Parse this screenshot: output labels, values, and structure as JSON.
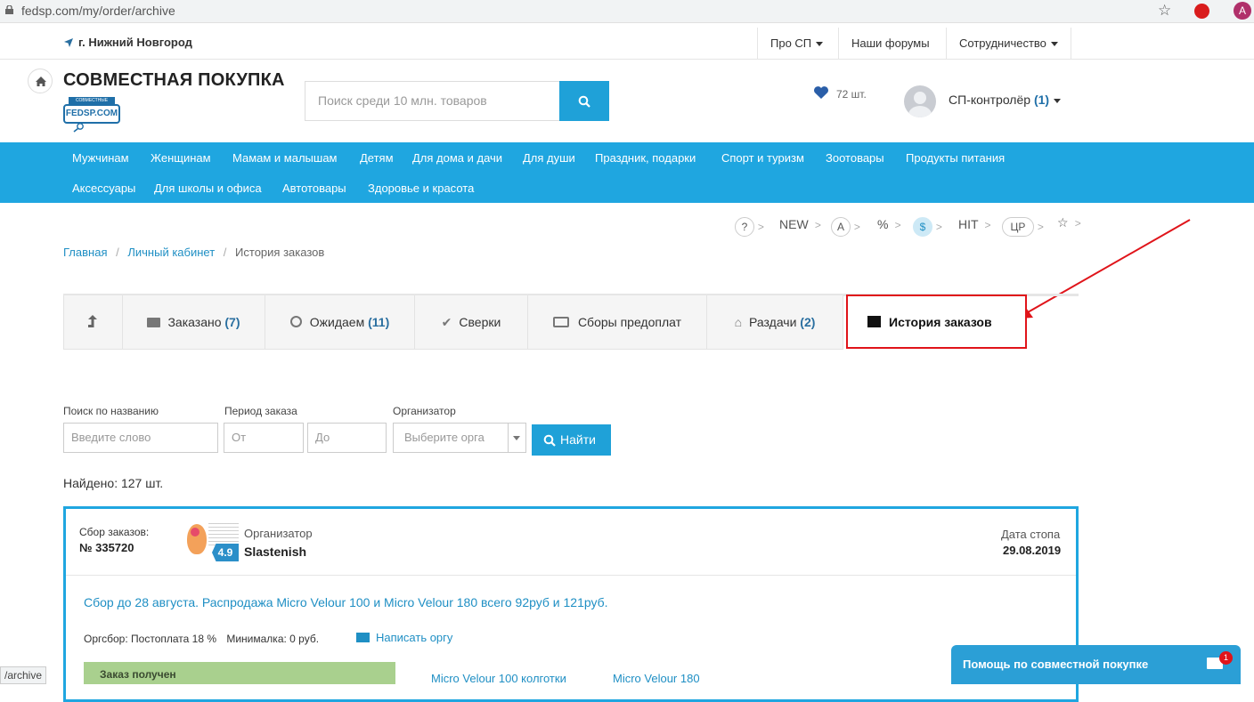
{
  "browser": {
    "url": "fedsp.com/my/order/archive",
    "avatar_letter": "A"
  },
  "topnav": {
    "city": "г. Нижний Новгород",
    "items": [
      "Про СП",
      "Наши форумы",
      "Сотрудничество"
    ]
  },
  "header": {
    "brand": "СОВМЕСТНАЯ ПОКУПКА",
    "logo_text": "FEDSP.COM",
    "logo_small": "СОВМЕСТНЫЕ ПОКУПКИ",
    "search_placeholder": "Поиск среди 10 млн. товаров",
    "fav_count": "72 шт.",
    "username": "СП-контролёр",
    "user_count": "(1)"
  },
  "menu": {
    "row1": [
      "Мужчинам",
      "Женщинам",
      "Мамам и малышам",
      "Детям",
      "Для дома и дачи",
      "Для души",
      "Праздник, подарки",
      "Спорт и туризм",
      "Зоотовары",
      "Продукты питания"
    ],
    "row2": [
      "Аксессуары",
      "Для школы и офиса",
      "Автотовары",
      "Здоровье и красота"
    ]
  },
  "filters": [
    "?",
    "NEW",
    "A",
    "%",
    "$",
    "HIT",
    "ЦР",
    "☆"
  ],
  "breadcrumb": [
    "Главная",
    "Личный кабинет",
    "История заказов"
  ],
  "tabs": {
    "ordered": "Заказано",
    "ordered_count": "(7)",
    "waiting": "Ожидаем",
    "waiting_count": "(11)",
    "checks": "Сверки",
    "prepay": "Сборы предоплат",
    "pickup": "Раздачи",
    "pickup_count": "(2)",
    "history": "История заказов"
  },
  "form": {
    "name_label": "Поиск по названию",
    "name_placeholder": "Введите слово",
    "period_label": "Период заказа",
    "from_placeholder": "От",
    "to_placeholder": "До",
    "org_label": "Организатор",
    "org_placeholder": "Выберите орга",
    "find_button": "Найти"
  },
  "found": "Найдено: 127 шт.",
  "card": {
    "label": "Сбор заказов:",
    "number": "№ 335720",
    "org_label": "Организатор",
    "org_name": "Slastenish",
    "rating": "4.9",
    "date_label": "Дата стопа",
    "date": "29.08.2019",
    "title": "Сбор до 28 августа. Распродажа Micro Velour 100 и Micro Velour 180 всего 92руб и 121руб.",
    "fee_label": "Оргсбор:",
    "fee": "Постоплата 18 %",
    "min_label": "Минималка:",
    "min": "0 руб.",
    "write": "Написать оргу",
    "status": "Заказ получен",
    "item1": "Micro Velour 100 колготки",
    "item2": "Micro Velour 180"
  },
  "chat": {
    "title": "Помощь по совместной покупке",
    "badge": "1"
  },
  "status_url": "/archive"
}
